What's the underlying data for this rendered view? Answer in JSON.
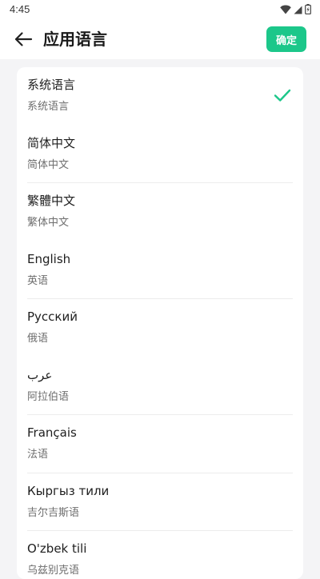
{
  "status_bar": {
    "time": "4:45",
    "icons": [
      "wifi-icon",
      "signal-icon",
      "battery-icon"
    ]
  },
  "header": {
    "back_icon": "arrow-left-icon",
    "title": "应用语言",
    "confirm_label": "确定"
  },
  "colors": {
    "accent": "#1cc78a",
    "background": "#f4f4f6",
    "card": "#ffffff"
  },
  "languages": [
    {
      "native": "系统语言",
      "name": "系统语言",
      "selected": true
    },
    {
      "native": "简体中文",
      "name": "简体中文",
      "selected": false
    },
    {
      "native": "繁體中文",
      "name": "繁体中文",
      "selected": false
    },
    {
      "native": "English",
      "name": "英语",
      "selected": false
    },
    {
      "native": "Русский",
      "name": "俄语",
      "selected": false
    },
    {
      "native": "عرب",
      "name": "阿拉伯语",
      "selected": false
    },
    {
      "native": "Français",
      "name": "法语",
      "selected": false
    },
    {
      "native": "Кыргыз тили",
      "name": "吉尔吉斯语",
      "selected": false
    },
    {
      "native": "O'zbek tili",
      "name": "乌兹别克语",
      "selected": false
    }
  ]
}
